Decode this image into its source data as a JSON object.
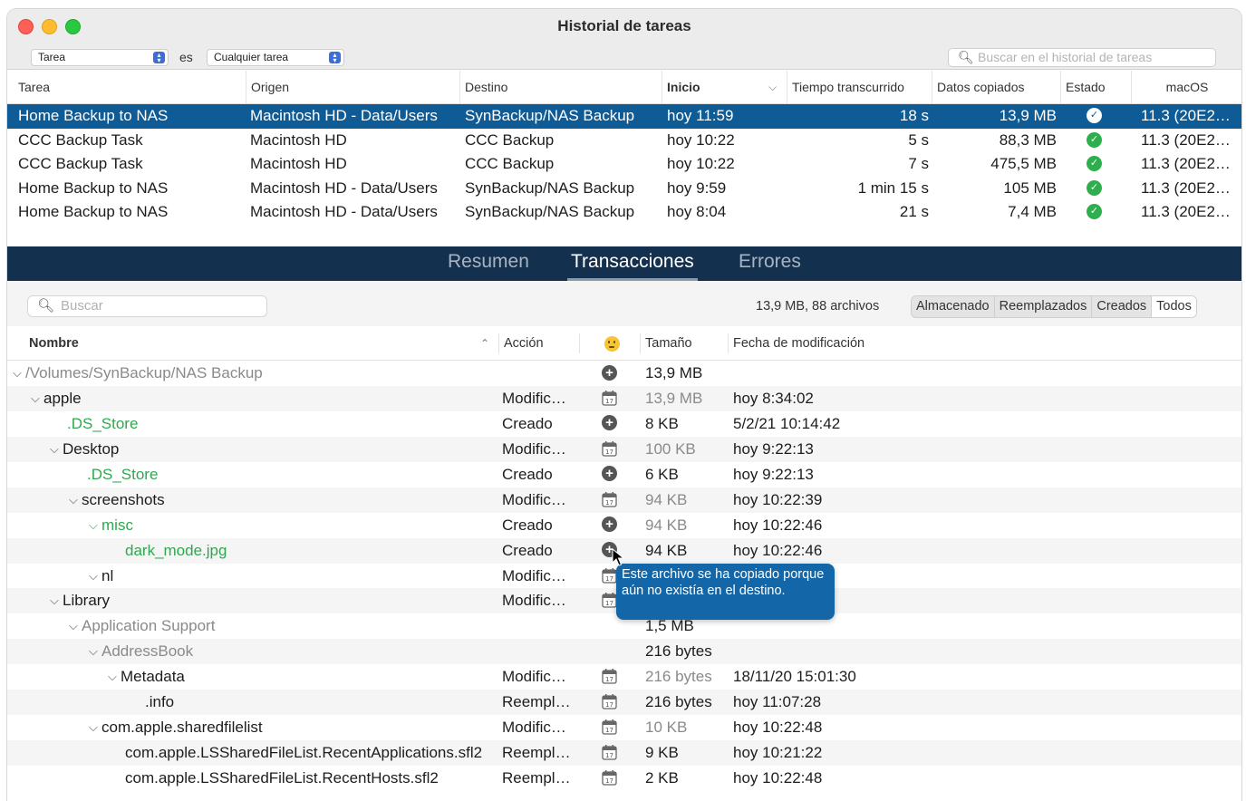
{
  "window": {
    "title": "Historial de tareas"
  },
  "filter": {
    "field": "Tarea",
    "operator": "es",
    "value": "Cualquier tarea",
    "search_placeholder": "Buscar en el historial de tareas"
  },
  "task_table": {
    "headers": {
      "tarea": "Tarea",
      "origen": "Origen",
      "destino": "Destino",
      "inicio": "Inicio",
      "tiempo": "Tiempo transcurrido",
      "datos": "Datos copiados",
      "estado": "Estado",
      "macos": "macOS"
    },
    "rows": [
      {
        "tarea": "Home Backup to NAS",
        "origen": "Macintosh HD - Data/Users",
        "destino": "SynBackup/NAS Backup",
        "inicio": "hoy 11:59",
        "tiempo": "18 s",
        "datos": "13,9 MB",
        "macos": "11.3 (20E2…"
      },
      {
        "tarea": "CCC Backup Task",
        "origen": "Macintosh HD",
        "destino": "CCC Backup",
        "inicio": "hoy 10:22",
        "tiempo": "5 s",
        "datos": "88,3 MB",
        "macos": "11.3 (20E2…"
      },
      {
        "tarea": "CCC Backup Task",
        "origen": "Macintosh HD",
        "destino": "CCC Backup",
        "inicio": "hoy 10:22",
        "tiempo": "7 s",
        "datos": "475,5 MB",
        "macos": "11.3 (20E2…"
      },
      {
        "tarea": "Home Backup to NAS",
        "origen": "Macintosh HD - Data/Users",
        "destino": "SynBackup/NAS Backup",
        "inicio": "hoy 9:59",
        "tiempo": "1 min 15 s",
        "datos": "105 MB",
        "macos": "11.3 (20E2…"
      },
      {
        "tarea": "Home Backup to NAS",
        "origen": "Macintosh HD - Data/Users",
        "destino": "SynBackup/NAS Backup",
        "inicio": "hoy 8:04",
        "tiempo": "21 s",
        "datos": "7,4 MB",
        "macos": "11.3 (20E2…"
      }
    ]
  },
  "tabs": {
    "resumen": "Resumen",
    "transacciones": "Transacciones",
    "errores": "Errores"
  },
  "transactions": {
    "search_placeholder": "Buscar",
    "summary": "13,9 MB, 88 archivos",
    "filters": [
      "Almacenado",
      "Reemplazados",
      "Creados",
      "Todos"
    ],
    "headers": {
      "nombre": "Nombre",
      "accion": "Acción",
      "tamano": "Tamaño",
      "fecha": "Fecha de modificación"
    },
    "rows": [
      {
        "name": "/Volumes/SynBackup/NAS Backup",
        "action": "",
        "icon": "plus",
        "size": "13,9 MB",
        "date": ""
      },
      {
        "name": "apple",
        "action": "Modific…",
        "icon": "calendar",
        "size": "13,9 MB",
        "date": "hoy 8:34:02"
      },
      {
        "name": ".DS_Store",
        "action": "Creado",
        "icon": "plus",
        "size": "8 KB",
        "date": "5/2/21 10:14:42"
      },
      {
        "name": "Desktop",
        "action": "Modific…",
        "icon": "calendar",
        "size": "100 KB",
        "date": "hoy 9:22:13"
      },
      {
        "name": ".DS_Store",
        "action": "Creado",
        "icon": "plus",
        "size": "6 KB",
        "date": "hoy 9:22:13"
      },
      {
        "name": "screenshots",
        "action": "Modific…",
        "icon": "calendar",
        "size": "94 KB",
        "date": "hoy 10:22:39"
      },
      {
        "name": "misc",
        "action": "Creado",
        "icon": "plus",
        "size": "94 KB",
        "date": "hoy 10:22:46"
      },
      {
        "name": "dark_mode.jpg",
        "action": "Creado",
        "icon": "plus",
        "size": "94 KB",
        "date": "hoy 10:22:46"
      },
      {
        "name": "nl",
        "action": "Modific…",
        "icon": "calendar",
        "size": "",
        "date": ""
      },
      {
        "name": "Library",
        "action": "Modific…",
        "icon": "calendar",
        "size": "",
        "date": ""
      },
      {
        "name": "Application Support",
        "action": "",
        "icon": "",
        "size": "1,5 MB",
        "date": ""
      },
      {
        "name": "AddressBook",
        "action": "",
        "icon": "",
        "size": "216 bytes",
        "date": ""
      },
      {
        "name": "Metadata",
        "action": "Modific…",
        "icon": "calendar",
        "size": "216 bytes",
        "date": "18/11/20 15:01:30"
      },
      {
        "name": ".info",
        "action": "Reempl…",
        "icon": "calendar",
        "size": "216 bytes",
        "date": "hoy 11:07:28"
      },
      {
        "name": "com.apple.sharedfilelist",
        "action": "Modific…",
        "icon": "calendar",
        "size": "10 KB",
        "date": "hoy 10:22:48"
      },
      {
        "name": "com.apple.LSSharedFileList.RecentApplications.sfl2",
        "action": "Reempl…",
        "icon": "calendar",
        "size": "9 KB",
        "date": "hoy 10:21:22"
      },
      {
        "name": "com.apple.LSSharedFileList.RecentHosts.sfl2",
        "action": "Reempl…",
        "icon": "calendar",
        "size": "2 KB",
        "date": "hoy 10:22:48"
      }
    ],
    "tooltip": "Este archivo se ha copiado porque aún no existía en el destino."
  }
}
